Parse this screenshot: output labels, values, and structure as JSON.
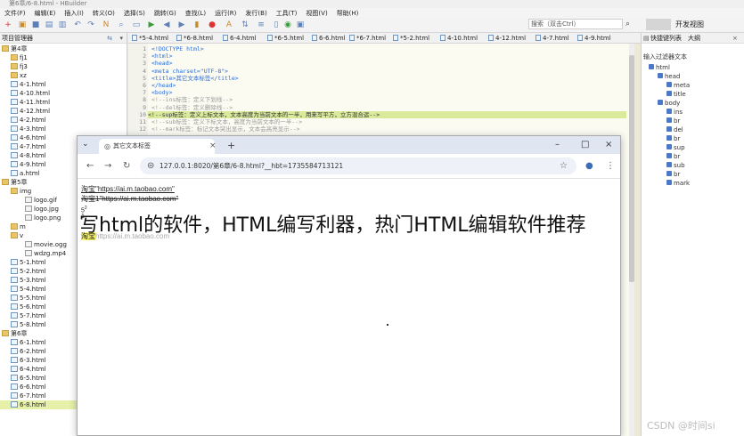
{
  "window_title": "第6章/6-8.html - HBuilder",
  "menu": [
    "文件(F)",
    "编辑(E)",
    "插入(I)",
    "转义(O)",
    "选择(S)",
    "跳转(G)",
    "查找(L)",
    "运行(R)",
    "发行(B)",
    "工具(T)",
    "视图(V)",
    "帮助(H)"
  ],
  "search": {
    "placeholder": "搜索（双击Ctrl）"
  },
  "preview_switch": "",
  "open_view_label": "开发视图",
  "left_panel": {
    "title": "项目管理器",
    "items": [
      {
        "label": "第4章",
        "type": "folder",
        "depth": 0
      },
      {
        "label": "fj1",
        "type": "folder",
        "depth": 1
      },
      {
        "label": "fj3",
        "type": "folder",
        "depth": 1
      },
      {
        "label": "xz",
        "type": "folder",
        "depth": 1
      },
      {
        "label": "4-1.html",
        "type": "file",
        "depth": 1
      },
      {
        "label": "4-10.html",
        "type": "file",
        "depth": 1
      },
      {
        "label": "4-11.html",
        "type": "file",
        "depth": 1
      },
      {
        "label": "4-12.html",
        "type": "file",
        "depth": 1
      },
      {
        "label": "4-2.html",
        "type": "file",
        "depth": 1
      },
      {
        "label": "4-3.html",
        "type": "file",
        "depth": 1
      },
      {
        "label": "4-6.html",
        "type": "file",
        "depth": 1
      },
      {
        "label": "4-7.html",
        "type": "file",
        "depth": 1
      },
      {
        "label": "4-8.html",
        "type": "file",
        "depth": 1
      },
      {
        "label": "4-9.html",
        "type": "file",
        "depth": 1
      },
      {
        "label": "a.html",
        "type": "file",
        "depth": 1
      },
      {
        "label": "第5章",
        "type": "folder",
        "depth": 0
      },
      {
        "label": "img",
        "type": "folder",
        "depth": 1
      },
      {
        "label": "logo.gif",
        "type": "img",
        "depth": 2
      },
      {
        "label": "logo.jpg",
        "type": "img",
        "depth": 2
      },
      {
        "label": "logo.png",
        "type": "img",
        "depth": 2
      },
      {
        "label": "m",
        "type": "folder",
        "depth": 1
      },
      {
        "label": "v",
        "type": "folder",
        "depth": 1
      },
      {
        "label": "movie.ogg",
        "type": "img",
        "depth": 2
      },
      {
        "label": "wdzg.mp4",
        "type": "img",
        "depth": 2
      },
      {
        "label": "5-1.html",
        "type": "file",
        "depth": 1
      },
      {
        "label": "5-2.html",
        "type": "file",
        "depth": 1
      },
      {
        "label": "5-3.html",
        "type": "file",
        "depth": 1
      },
      {
        "label": "5-4.html",
        "type": "file",
        "depth": 1
      },
      {
        "label": "5-5.html",
        "type": "file",
        "depth": 1
      },
      {
        "label": "5-6.html",
        "type": "file",
        "depth": 1
      },
      {
        "label": "5-7.html",
        "type": "file",
        "depth": 1
      },
      {
        "label": "5-8.html",
        "type": "file",
        "depth": 1
      },
      {
        "label": "第6章",
        "type": "folder",
        "depth": 0
      },
      {
        "label": "6-1.html",
        "type": "file",
        "depth": 1
      },
      {
        "label": "6-2.html",
        "type": "file",
        "depth": 1
      },
      {
        "label": "6-3.html",
        "type": "file",
        "depth": 1
      },
      {
        "label": "6-4.html",
        "type": "file",
        "depth": 1
      },
      {
        "label": "6-5.html",
        "type": "file",
        "depth": 1
      },
      {
        "label": "6-6.html",
        "type": "file",
        "depth": 1
      },
      {
        "label": "6-7.html",
        "type": "file",
        "depth": 1
      },
      {
        "label": "6-8.html",
        "type": "file",
        "depth": 1,
        "selected": true
      }
    ]
  },
  "tabs": [
    "*5-4.html",
    "*6-8.html",
    "6-4.html",
    "*6-5.html",
    "6-6.html",
    "*6-7.html",
    "*5-2.html",
    "4-10.html",
    "4-12.html",
    "4-7.html",
    "4-9.html"
  ],
  "editor": {
    "lines": [
      {
        "n": "1",
        "text": "<!DOCTYPE html>"
      },
      {
        "n": "2",
        "text": "<html>"
      },
      {
        "n": "3",
        "text": "    <head>"
      },
      {
        "n": "4",
        "text": "        <meta charset=\"UTF-8\">"
      },
      {
        "n": "5",
        "text": "        <title>其它文本标签</title>"
      },
      {
        "n": "6",
        "text": "    </head>"
      },
      {
        "n": "7",
        "text": "    <body>"
      },
      {
        "n": "8",
        "text": "        <!--ins标签：定义下划线-->"
      },
      {
        "n": "9",
        "text": "        <!--del标签：定义删除线-->"
      },
      {
        "n": "10",
        "text": "        <!--sup标签：定义上标文本，文本高度为当前文本的一半，用来写平方，立方混合运-->",
        "highlight": true
      },
      {
        "n": "11",
        "text": "        <!--sub标签：定义下标文本，高度为当前文本的一半-->"
      },
      {
        "n": "12",
        "text": "        <!--mark标签：标记文本突出显示，文本会高亮显示-->"
      }
    ]
  },
  "right_panel": {
    "tabs": [
      "快捷键列表",
      "大纲"
    ],
    "filter_label": "输入过滤器文本",
    "outline": [
      {
        "label": "html",
        "depth": 0
      },
      {
        "label": "head",
        "depth": 1
      },
      {
        "label": "meta",
        "depth": 2
      },
      {
        "label": "title",
        "depth": 2
      },
      {
        "label": "body",
        "depth": 1
      },
      {
        "label": "ins",
        "depth": 2
      },
      {
        "label": "br",
        "depth": 2
      },
      {
        "label": "del",
        "depth": 2
      },
      {
        "label": "br",
        "depth": 2
      },
      {
        "label": "sup",
        "depth": 2
      },
      {
        "label": "br",
        "depth": 2
      },
      {
        "label": "sub",
        "depth": 2
      },
      {
        "label": "br",
        "depth": 2
      },
      {
        "label": "mark",
        "depth": 2
      }
    ]
  },
  "browser": {
    "tab_title": "其它文本标签",
    "url": "127.0.0.1:8020/第6章/6-8.html?__hbt=1735584713121",
    "content": {
      "line1": "淘宝\"https://ai.m.taobao.com\"",
      "line2": "淘宝1\"https://ai.m.taobao.com\"",
      "line3_sup": "5",
      "line3_num": "2",
      "line4": "1",
      "line5_mark": "淘宝",
      "line5_rest": "https://ai.m.taobao.com"
    }
  },
  "overlay_title": "写html的软件，HTML编写利器，热门HTML编辑软件推荐",
  "watermark": "CSDN @时间si"
}
